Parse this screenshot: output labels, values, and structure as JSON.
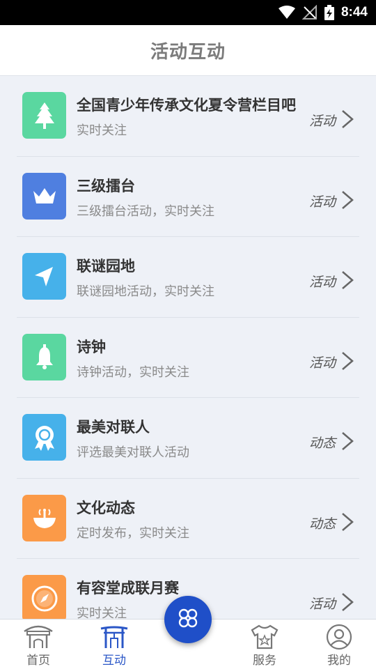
{
  "status_bar": {
    "time": "8:44"
  },
  "header": {
    "title": "活动互动"
  },
  "colors": {
    "accent": "#1f4fc8",
    "green": "#5ad7a0",
    "blue": "#4f7fe0",
    "sky": "#46b1ea",
    "orange": "#fb9a48"
  },
  "list": [
    {
      "title": "全国青少年传承文化夏令营栏目吧",
      "subtitle": "实时关注",
      "tag": "活动",
      "icon": "tree-icon",
      "color": "#5ad7a0"
    },
    {
      "title": "三级擂台",
      "subtitle": "三级擂台活动，实时关注",
      "tag": "活动",
      "icon": "crown-icon",
      "color": "#4f7fe0"
    },
    {
      "title": "联谜园地",
      "subtitle": "联谜园地活动，实时关注",
      "tag": "活动",
      "icon": "navigation-arrow-icon",
      "color": "#46b1ea"
    },
    {
      "title": "诗钟",
      "subtitle": "诗钟活动，实时关注",
      "tag": "活动",
      "icon": "bell-icon",
      "color": "#5ad7a0"
    },
    {
      "title": "最美对联人",
      "subtitle": "评选最美对联人活动",
      "tag": "动态",
      "icon": "award-ribbon-icon",
      "color": "#46b1ea"
    },
    {
      "title": "文化动态",
      "subtitle": "定时发布，实时关注",
      "tag": "动态",
      "icon": "broadcast-bowl-icon",
      "color": "#fb9a48"
    },
    {
      "title": "有容堂成联月赛",
      "subtitle": "实时关注",
      "tag": "活动",
      "icon": "compass-icon",
      "color": "#fb9a48"
    }
  ],
  "bottom_nav": [
    {
      "label": "首页",
      "icon": "home-gate-icon",
      "active": false
    },
    {
      "label": "互动",
      "icon": "pavilion-icon",
      "active": true
    },
    {
      "label": "服务",
      "icon": "service-shirt-icon",
      "active": false
    },
    {
      "label": "我的",
      "icon": "profile-icon",
      "active": false
    }
  ],
  "fab": {
    "icon": "clover-icon"
  }
}
